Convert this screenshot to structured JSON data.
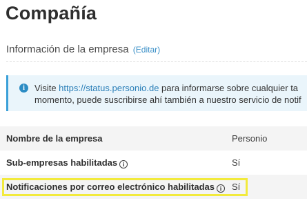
{
  "page": {
    "title": "Compañía"
  },
  "section": {
    "title": "Información de la empresa",
    "edit_label": "(Editar)"
  },
  "info": {
    "icon": "info-icon",
    "line1_prefix": "Visite ",
    "link": "https://status.personio.de",
    "line1_suffix": " para informarse sobre cualquier ta",
    "line2": "momento, puede suscribirse ahí también a nuestro servicio de notif"
  },
  "rows": [
    {
      "label": "Nombre de la empresa",
      "value": "Personio",
      "has_hint": false
    },
    {
      "label": "Sub-empresas habilitadas",
      "value": "Sí",
      "has_hint": true
    },
    {
      "label": "Notificaciones por correo electrónico habilitadas",
      "value": "Sí",
      "has_hint": true
    }
  ],
  "colors": {
    "link": "#2b7fb8",
    "info_bg": "#eaf5fb",
    "info_accent": "#3aa0d8",
    "highlight": "#f2ea3c",
    "row_alt": "#f4f4f4"
  }
}
